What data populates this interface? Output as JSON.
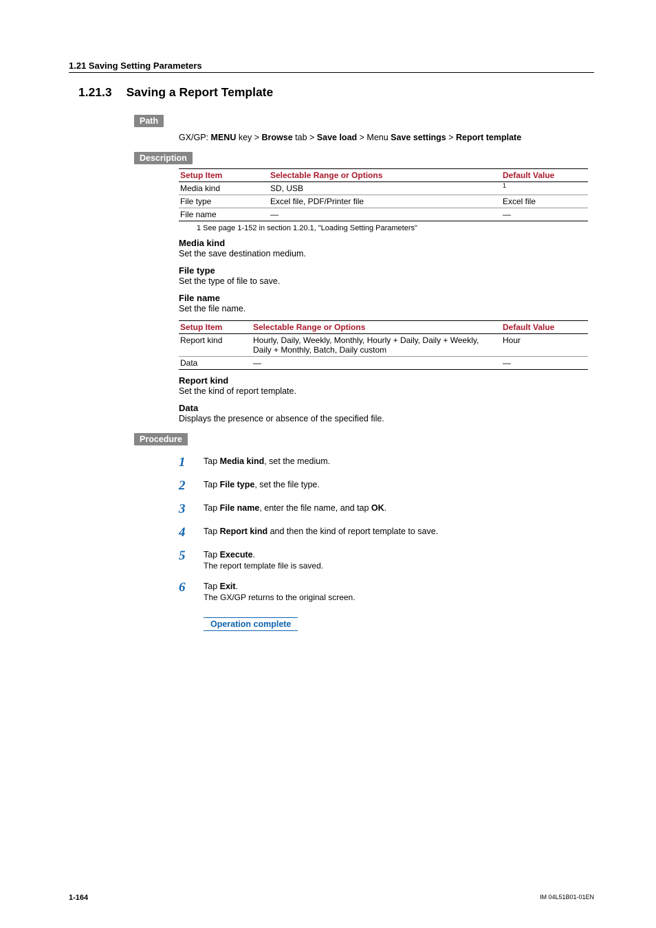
{
  "header_bar": "1.21  Saving Setting Parameters",
  "title": {
    "num": "1.21.3",
    "text": "Saving a Report Template"
  },
  "labels": {
    "path": "Path",
    "description": "Description",
    "procedure": "Procedure"
  },
  "path_line": {
    "prefix": "GX/GP: ",
    "p1": "MENU",
    "p1s": " key > ",
    "p2": "Browse",
    "p2s": " tab > ",
    "p3": "Save load",
    "p3s": " > Menu ",
    "p4": "Save settings",
    "p4s": " > ",
    "p5": "Report template"
  },
  "table1": {
    "h1": "Setup Item",
    "h2": "Selectable Range or Options",
    "h3": "Default Value",
    "rows": [
      {
        "c1": "Media kind",
        "c2": "SD, USB",
        "c3sup": "1"
      },
      {
        "c1": "File type",
        "c2": "Excel file, PDF/Printer file",
        "c3": "Excel file"
      },
      {
        "c1": "File name",
        "c2": "―",
        "c3": "―"
      }
    ]
  },
  "footnote": "1   See page 1-152 in section 1.20.1, \"Loading Setting Parameters\"",
  "desc_items1": [
    {
      "h": "Media kind",
      "p": "Set the save destination medium."
    },
    {
      "h": "File type",
      "p": "Set the type of file to save."
    },
    {
      "h": "File name",
      "p": "Set the file name."
    }
  ],
  "table2": {
    "h1": "Setup Item",
    "h2": "Selectable Range or Options",
    "h3": "Default Value",
    "rows": [
      {
        "c1": "Report kind",
        "c2": "Hourly, Daily, Weekly, Monthly, Hourly + Daily, Daily + Weekly, Daily + Monthly, Batch, Daily custom",
        "c3": "Hour"
      },
      {
        "c1": "Data",
        "c2": "―",
        "c3": "―"
      }
    ]
  },
  "desc_items2": [
    {
      "h": "Report kind",
      "p": "Set the kind of report template."
    },
    {
      "h": "Data",
      "p": "Displays the presence or absence of the specified file."
    }
  ],
  "procedure": [
    {
      "n": "1",
      "pre": "Tap ",
      "b": "Media kind",
      "post": ", set the medium."
    },
    {
      "n": "2",
      "pre": "Tap ",
      "b": "File type",
      "post": ", set the file type."
    },
    {
      "n": "3",
      "pre": "Tap ",
      "b": "File name",
      "post": ", enter the file name, and tap ",
      "b2": "OK",
      "post2": "."
    },
    {
      "n": "4",
      "pre": "Tap ",
      "b": "Report kind",
      "post": " and then the kind of report template to save."
    },
    {
      "n": "5",
      "pre": "Tap ",
      "b": "Execute",
      "post": ".",
      "sub": "The report template file is saved."
    },
    {
      "n": "6",
      "pre": "Tap ",
      "b": "Exit",
      "post": ".",
      "sub": "The GX/GP returns to the original screen."
    }
  ],
  "op_complete": "Operation complete",
  "footer": {
    "page": "1-164",
    "doc": "IM 04L51B01-01EN"
  }
}
